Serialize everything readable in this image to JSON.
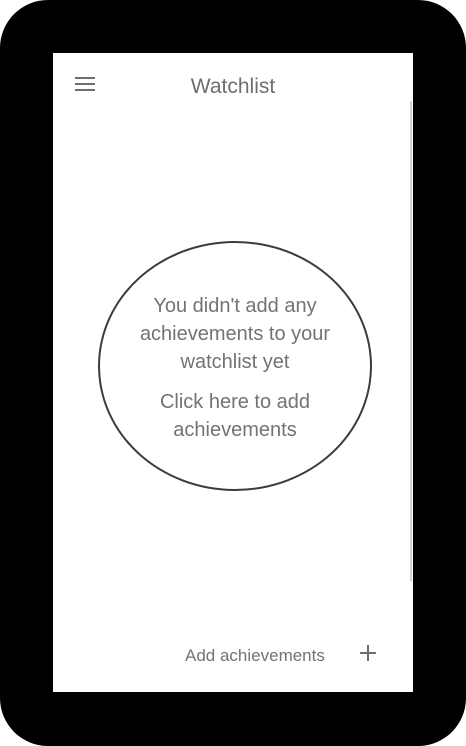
{
  "header": {
    "menu_icon": "hamburger-menu-icon",
    "title": "Watchlist"
  },
  "empty_state": {
    "message": "You didn't add any achievements to your watchlist yet",
    "cta": "Click here to add achievements"
  },
  "footer": {
    "add_label": "Add achievements",
    "add_icon": "plus-icon"
  }
}
